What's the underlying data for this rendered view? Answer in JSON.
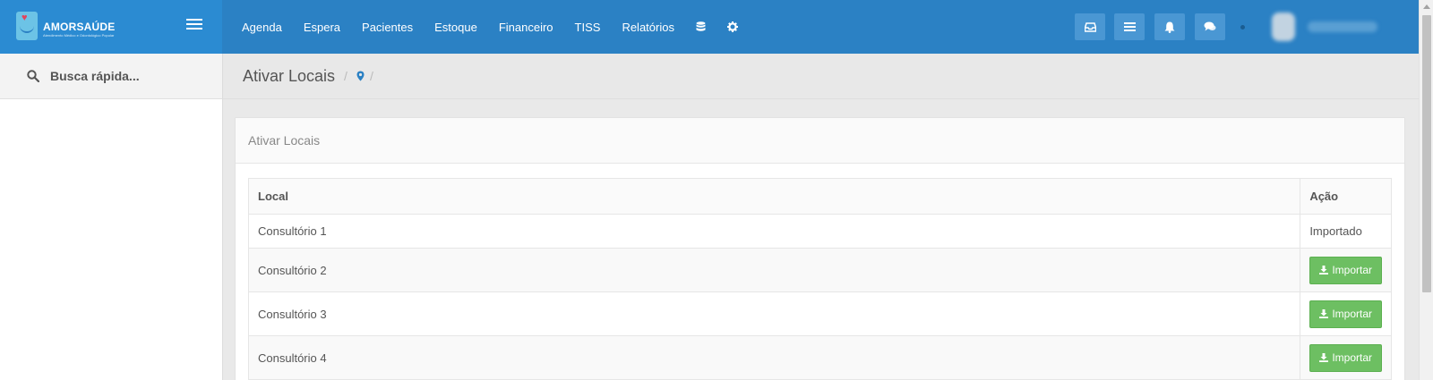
{
  "brand": {
    "name": "AMORSAÚDE",
    "tagline": "Atendimento Médico e Odontológico Popular"
  },
  "topnav": {
    "items": [
      "Agenda",
      "Espera",
      "Pacientes",
      "Estoque",
      "Financeiro",
      "TISS",
      "Relatórios"
    ],
    "icons": [
      "database-icon",
      "gear-icon"
    ]
  },
  "toolbar_icons": [
    "inbox-icon",
    "list-icon",
    "bell-icon",
    "chat-icon"
  ],
  "sidebar": {
    "search_label": "Busca rápida..."
  },
  "breadcrumb": {
    "title": "Ativar Locais",
    "icon": "map-marker-icon",
    "separator": "/"
  },
  "panel": {
    "title": "Ativar Locais"
  },
  "table": {
    "columns": [
      "Local",
      "Ação"
    ],
    "rows": [
      {
        "local": "Consultório 1",
        "action": "Importado",
        "type": "text"
      },
      {
        "local": "Consultório 2",
        "action": "Importar",
        "type": "button"
      },
      {
        "local": "Consultório 3",
        "action": "Importar",
        "type": "button"
      },
      {
        "local": "Consultório 4",
        "action": "Importar",
        "type": "button"
      }
    ]
  },
  "colors": {
    "topbar": "#2b81c4",
    "brand_bg": "#2b8bd2",
    "import_button": "#6dbf62",
    "breadcrumb_icon": "#2b81c4"
  }
}
